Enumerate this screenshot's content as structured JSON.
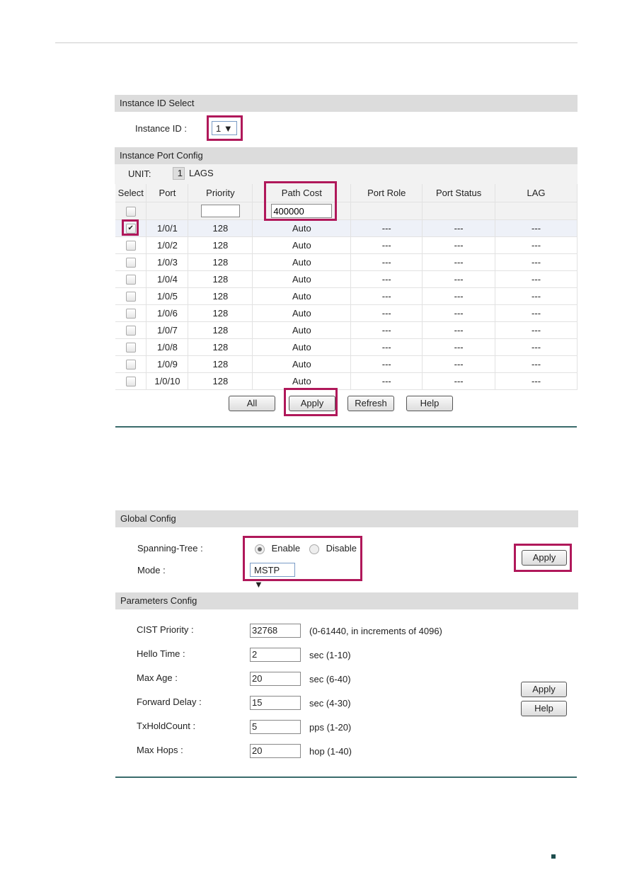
{
  "instance": {
    "section_title": "Instance ID Select",
    "instance_id_label": "Instance ID :",
    "instance_id_value": "1 ▼",
    "port_config_title": "Instance Port Config",
    "unit_label": "UNIT:",
    "unit_value": "1",
    "lags_label": "LAGS",
    "columns": [
      "Select",
      "Port",
      "Priority",
      "Path Cost",
      "Port Role",
      "Port Status",
      "LAG"
    ],
    "priority_input": "",
    "path_cost_input": "400000",
    "rows": [
      {
        "checked": true,
        "port": "1/0/1",
        "priority": "128",
        "path_cost": "Auto",
        "role": "---",
        "status": "---",
        "lag": "---"
      },
      {
        "checked": false,
        "port": "1/0/2",
        "priority": "128",
        "path_cost": "Auto",
        "role": "---",
        "status": "---",
        "lag": "---"
      },
      {
        "checked": false,
        "port": "1/0/3",
        "priority": "128",
        "path_cost": "Auto",
        "role": "---",
        "status": "---",
        "lag": "---"
      },
      {
        "checked": false,
        "port": "1/0/4",
        "priority": "128",
        "path_cost": "Auto",
        "role": "---",
        "status": "---",
        "lag": "---"
      },
      {
        "checked": false,
        "port": "1/0/5",
        "priority": "128",
        "path_cost": "Auto",
        "role": "---",
        "status": "---",
        "lag": "---"
      },
      {
        "checked": false,
        "port": "1/0/6",
        "priority": "128",
        "path_cost": "Auto",
        "role": "---",
        "status": "---",
        "lag": "---"
      },
      {
        "checked": false,
        "port": "1/0/7",
        "priority": "128",
        "path_cost": "Auto",
        "role": "---",
        "status": "---",
        "lag": "---"
      },
      {
        "checked": false,
        "port": "1/0/8",
        "priority": "128",
        "path_cost": "Auto",
        "role": "---",
        "status": "---",
        "lag": "---"
      },
      {
        "checked": false,
        "port": "1/0/9",
        "priority": "128",
        "path_cost": "Auto",
        "role": "---",
        "status": "---",
        "lag": "---"
      },
      {
        "checked": false,
        "port": "1/0/10",
        "priority": "128",
        "path_cost": "Auto",
        "role": "---",
        "status": "---",
        "lag": "---"
      }
    ],
    "buttons": {
      "all": "All",
      "apply": "Apply",
      "refresh": "Refresh",
      "help": "Help"
    }
  },
  "global": {
    "section_title": "Global Config",
    "spanning_tree_label": "Spanning-Tree :",
    "enable_label": "Enable",
    "disable_label": "Disable",
    "enabled": true,
    "mode_label": "Mode :",
    "mode_value": "MSTP ▼",
    "apply": "Apply"
  },
  "params": {
    "section_title": "Parameters Config",
    "fields": [
      {
        "label": "CIST Priority :",
        "value": "32768",
        "hint": "(0-61440, in increments of 4096)"
      },
      {
        "label": "Hello Time :",
        "value": "2",
        "hint": "sec (1-10)"
      },
      {
        "label": "Max Age :",
        "value": "20",
        "hint": "sec (6-40)"
      },
      {
        "label": "Forward Delay :",
        "value": "15",
        "hint": "sec (4-30)"
      },
      {
        "label": "TxHoldCount :",
        "value": "5",
        "hint": "pps (1-20)"
      },
      {
        "label": "Max Hops :",
        "value": "20",
        "hint": "hop (1-40)"
      }
    ],
    "apply": "Apply",
    "help": "Help"
  },
  "colors": {
    "highlight": "#b0185a",
    "rule": "#3a6b6b"
  }
}
